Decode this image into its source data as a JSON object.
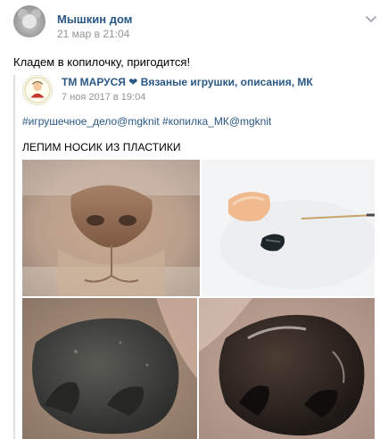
{
  "post": {
    "author": "Мышкин дом",
    "date": "21 мар в 21:04",
    "text": "Кладем в копилочку, пригодится!"
  },
  "repost": {
    "author": "ТМ МАРУСЯ",
    "heart": "❤",
    "group": "Вязаные игрушки, описания, МК",
    "date": "7 ноя 2017 в 19:04",
    "hashtags": "#игрушечное_дело@mgknit #копилка_МК@mgknit",
    "caption": "ЛЕПИМ НОСИК ИЗ ПЛАСТИКИ"
  },
  "icons": {
    "menu": "chevron-down-icon",
    "avatar": "mouse-avatar",
    "group_logo": "marusya-logo"
  },
  "colors": {
    "link": "#2a5885",
    "meta": "#939393",
    "divider": "#dce1e6"
  }
}
